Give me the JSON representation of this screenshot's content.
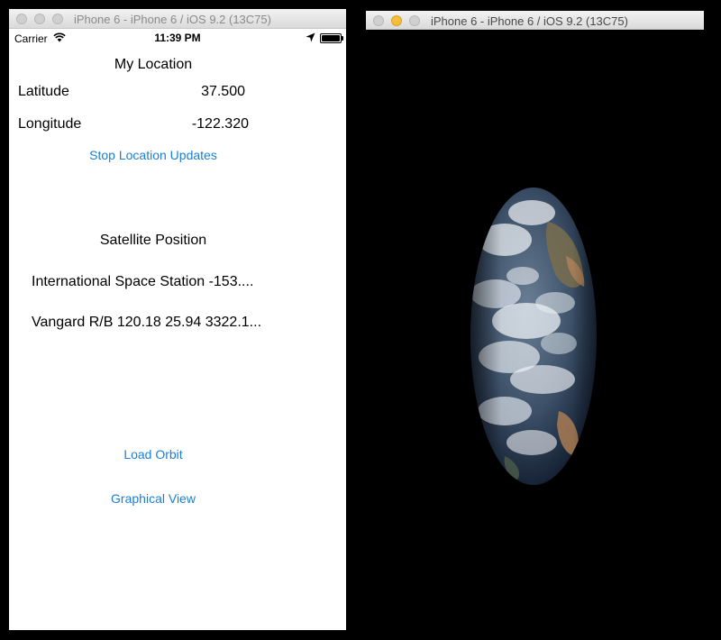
{
  "left_window": {
    "title": "iPhone 6 - iPhone 6 / iOS 9.2 (13C75)"
  },
  "right_window": {
    "title": "iPhone 6 - iPhone 6 / iOS 9.2 (13C75)"
  },
  "status_bar": {
    "carrier": "Carrier",
    "time": "11:39 PM"
  },
  "location": {
    "title": "My Location",
    "latitude_label": "Latitude",
    "latitude_value": "37.500",
    "longitude_label": "Longitude",
    "longitude_value": "-122.320",
    "stop_button": "Stop Location Updates"
  },
  "satellites": {
    "title": "Satellite Position",
    "items": [
      "International Space Station -153....",
      "Vangard R/B 120.18 25.94 3322.1..."
    ]
  },
  "actions": {
    "load_orbit": "Load Orbit",
    "graphical_view": "Graphical View"
  },
  "colors": {
    "ios_tint": "#1a7fd8",
    "background": "#000000"
  },
  "icons": [
    "wifi-icon",
    "location-arrow-icon",
    "battery-icon",
    "earth-globe"
  ]
}
